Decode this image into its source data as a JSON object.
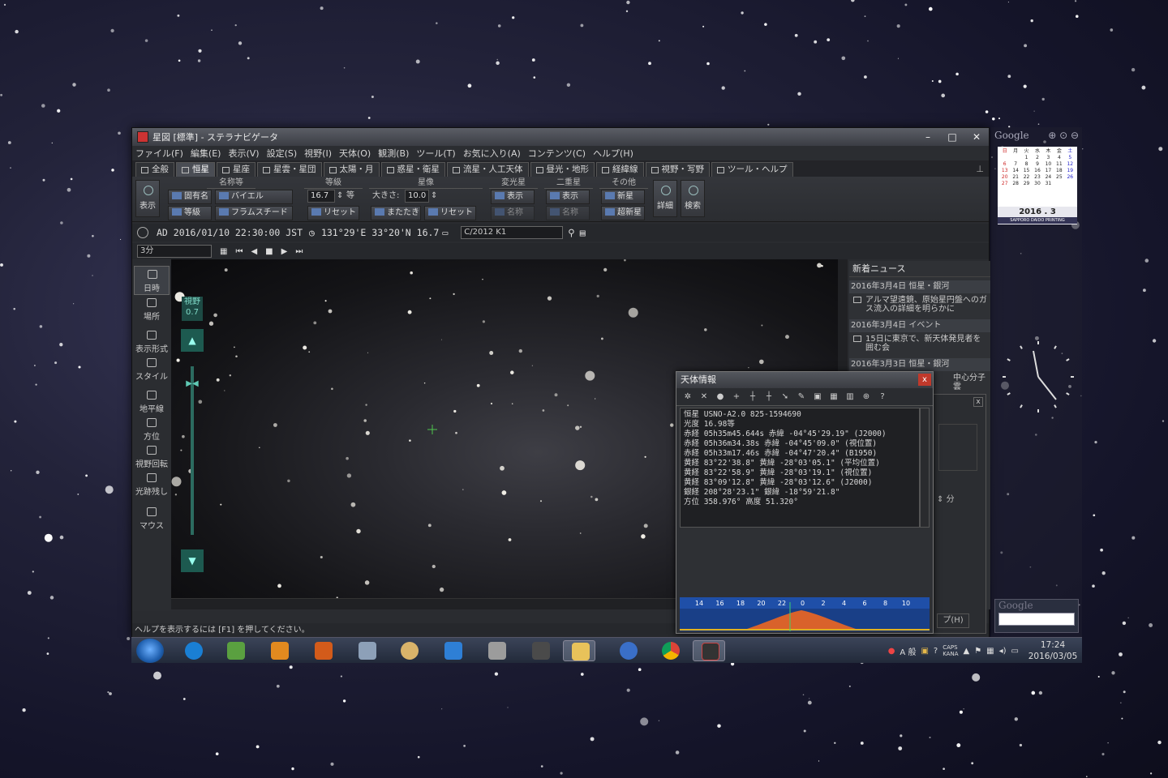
{
  "window": {
    "title": "星図 [標準] - ステラナビゲータ",
    "controls": [
      "–",
      "□",
      "✕"
    ]
  },
  "menu": [
    "ファイル(F)",
    "編集(E)",
    "表示(V)",
    "設定(S)",
    "視野(I)",
    "天体(O)",
    "観測(B)",
    "ツール(T)",
    "お気に入り(A)",
    "コンテンツ(C)",
    "ヘルプ(H)"
  ],
  "tabs": [
    {
      "label": "全般"
    },
    {
      "label": "恒星",
      "active": true
    },
    {
      "label": "星座"
    },
    {
      "label": "星雲・星団"
    },
    {
      "label": "太陽・月"
    },
    {
      "label": "惑星・衛星"
    },
    {
      "label": "流星・人工天体"
    },
    {
      "label": "昼光・地形"
    },
    {
      "label": "経緯線"
    },
    {
      "label": "視野・写野"
    },
    {
      "label": "ツール・ヘルプ"
    }
  ],
  "ribbon": {
    "display_btn": "表示",
    "group_names": "名称等",
    "group_magnitude": "等級",
    "group_image": "星像",
    "group_variable": "変光星",
    "group_double": "二重星",
    "group_other": "その他",
    "proper_name": "固有名",
    "bayer": "バイエル",
    "magnitude_btn": "等級",
    "flamsteed": "フラムスチード",
    "mag_value": "16.7",
    "mag_unit": "等",
    "reset": "リセット",
    "size_label": "大きさ:",
    "size_value": "10.0",
    "twinkle": "またたき",
    "show": "表示",
    "name": "名称",
    "nova": "新星",
    "supernova": "超新星",
    "detail": "詳細",
    "search": "検索"
  },
  "status": {
    "datetime": "AD 2016/01/10 22:30:00 JST",
    "coords": "131°29'E 33°20'N 16.7",
    "target": "C/2012 K1",
    "step": "3分"
  },
  "left_toolbar": [
    "日時",
    "場所",
    "表示形式",
    "スタイル",
    "地平線",
    "方位",
    "視野回転",
    "光跡残し",
    "マウス"
  ],
  "fov": {
    "label": "視野",
    "value": "0.7"
  },
  "news": {
    "title": "新着ニュース",
    "items": [
      {
        "date": "2016年3月4日 恒星・銀河",
        "text": "アルマ望遠鏡、原始星円盤へのガス流入の詳細を明らかに"
      },
      {
        "date": "2016年3月4日 イベント",
        "text": "15日に東京で、新天体発見者を囲む会"
      },
      {
        "date": "2016年3月3日 恒星・銀河",
        "text": "中心分子雲"
      }
    ]
  },
  "help_text": "ヘルプを表示するには [F1] を押してください。",
  "info_window": {
    "title": "天体情報",
    "close": "x",
    "lines": [
      "恒星 USNO-A2.0 825-1594690",
      "光度 16.98等",
      "赤経 05h35m45.644s  赤緯 -04°45'29.19\" (J2000)",
      "赤経 05h36m34.38s   赤緯 -04°45'09.0\"  (視位置)",
      "赤経 05h33m17.46s   赤緯 -04°47'20.4\"  (B1950)",
      "黄経  83°22'38.8\"   黄緯 -28°03'05.1\"  (平均位置)",
      "黄経  83°22'58.9\"   黄緯 -28°03'19.1\"  (視位置)",
      "黄経  83°09'12.8\"   黄緯 -28°03'12.6\"  (J2000)",
      "銀経 208°28'23.1\"   銀緯 -18°59'21.8\"",
      "方位 358.976°        高度  51.320°"
    ],
    "hour_ticks": [
      "14",
      "16",
      "18",
      "20",
      "22",
      "0",
      "2",
      "4",
      "6",
      "8",
      "10"
    ]
  },
  "side_dialog": {
    "close": "x",
    "minute_label": "分",
    "help_label": "プ(H)"
  },
  "gadgets": {
    "google_label": "Google",
    "calendar": {
      "weekdays": [
        "日",
        "月",
        "火",
        "水",
        "木",
        "金",
        "土"
      ],
      "days": [
        "",
        "",
        "1",
        "2",
        "3",
        "4",
        "5",
        "6",
        "7",
        "8",
        "9",
        "10",
        "11",
        "12",
        "13",
        "14",
        "15",
        "16",
        "17",
        "18",
        "19",
        "20",
        "21",
        "22",
        "23",
        "24",
        "25",
        "26",
        "27",
        "28",
        "29",
        "30",
        "31",
        "",
        ""
      ],
      "year_month": "2016 . 3",
      "brand": "SAPPORO DAIDO PRINTING"
    },
    "search_label": "Google"
  },
  "taskbar": {
    "time": "17:24",
    "date": "2016/03/05",
    "ime": "A 般",
    "caps": "CAPS",
    "kana": "KANA"
  },
  "colors": {
    "accent": "#1d5a50",
    "chart_orange": "#d9622b",
    "chart_blue": "#1f4fa8"
  }
}
